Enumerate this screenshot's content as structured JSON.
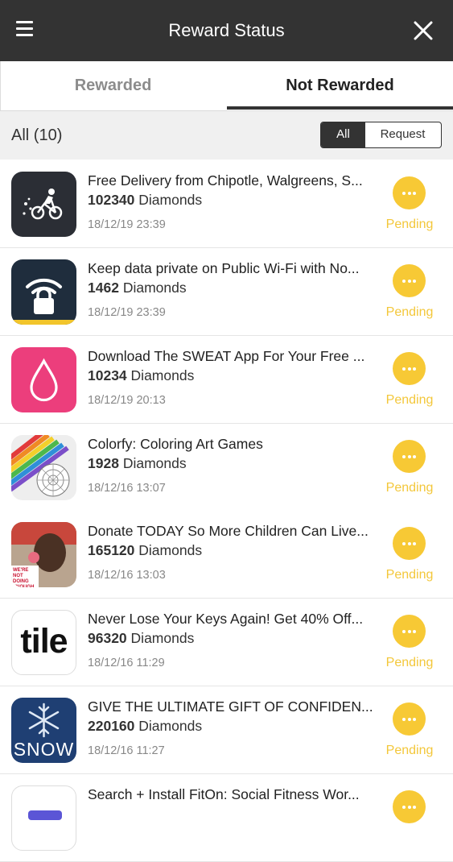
{
  "header": {
    "title": "Reward Status"
  },
  "tabs": [
    {
      "label": "Rewarded"
    },
    {
      "label": "Not Rewarded"
    }
  ],
  "filter": {
    "count_label": "All (10)",
    "segment_all": "All",
    "segment_request": "Request"
  },
  "rows": [
    {
      "title": "Free Delivery from Chipotle, Walgreens, S...",
      "amount": "102340",
      "unit": "Diamonds",
      "date": "18/12/19 23:39",
      "status": "Pending",
      "icon": "postmates-icon"
    },
    {
      "title": "Keep data private on Public Wi-Fi with No...",
      "amount": "1462",
      "unit": "Diamonds",
      "date": "18/12/19 23:39",
      "status": "Pending",
      "icon": "wifi-lock-icon"
    },
    {
      "title": "Download The SWEAT App For Your Free ...",
      "amount": "10234",
      "unit": "Diamonds",
      "date": "18/12/19 20:13",
      "status": "Pending",
      "icon": "sweat-drop-icon"
    },
    {
      "title": "Colorfy: Coloring Art Games",
      "amount": "1928",
      "unit": "Diamonds",
      "date": "18/12/16 13:07",
      "status": "Pending",
      "icon": "colorfy-pencils-icon"
    },
    {
      "title": "Donate TODAY So More Children Can Live...",
      "amount": "165120",
      "unit": "Diamonds",
      "date": "18/12/16 13:03",
      "status": "Pending",
      "icon": "charity-child-icon",
      "icon_text": "WE'RE NOT DOING ENOUGH"
    },
    {
      "title": "Never Lose Your Keys Again! Get 40% Off...",
      "amount": "96320",
      "unit": "Diamonds",
      "date": "18/12/16 11:29",
      "status": "Pending",
      "icon": "tile-logo-icon",
      "icon_text": "tile"
    },
    {
      "title": "GIVE THE ULTIMATE GIFT OF CONFIDEN...",
      "amount": "220160",
      "unit": "Diamonds",
      "date": "18/12/16 11:27",
      "status": "Pending",
      "icon": "snow-logo-icon",
      "icon_text": "SNOW"
    },
    {
      "title": "Search + Install FitOn: Social Fitness Wor...",
      "amount": "",
      "unit": "",
      "date": "",
      "status": "",
      "icon": "fiton-icon"
    }
  ],
  "colors": {
    "header_bg": "#333333",
    "pending": "#f7c935",
    "status_text": "#f3c73a"
  }
}
